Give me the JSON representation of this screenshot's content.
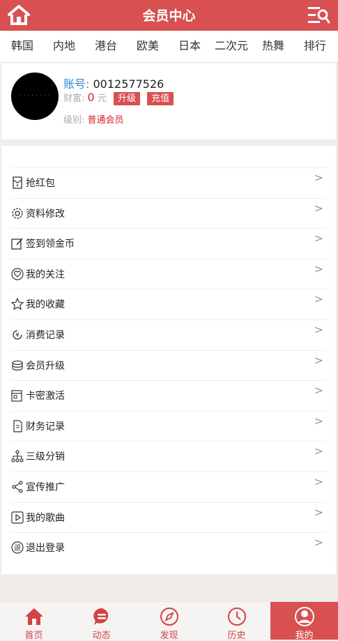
{
  "header": {
    "title": "会员中心"
  },
  "nav": [
    "韩国",
    "内地",
    "港台",
    "欧美",
    "日本",
    "二次元",
    "热舞",
    "排行"
  ],
  "profile": {
    "account_label": "账号:",
    "account_value": "0012577526",
    "wealth_label": "财富:",
    "wealth_value": "0",
    "wealth_unit": "元",
    "upgrade_button": "升级",
    "recharge_button": "充值",
    "level_label": "级别:",
    "level_value": "普通会员"
  },
  "menu": [
    {
      "label": "抢红包",
      "icon": "red-envelope-icon"
    },
    {
      "label": "资料修改",
      "icon": "gear-icon"
    },
    {
      "label": "签到领金币",
      "icon": "edit-icon"
    },
    {
      "label": "我的关注",
      "icon": "heart-icon"
    },
    {
      "label": "我的收藏",
      "icon": "star-icon"
    },
    {
      "label": "消费记录",
      "icon": "yen-icon"
    },
    {
      "label": "会员升级",
      "icon": "coins-icon"
    },
    {
      "label": "卡密激活",
      "icon": "card-icon"
    },
    {
      "label": "财务记录",
      "icon": "document-icon"
    },
    {
      "label": "三级分销",
      "icon": "hierarchy-icon"
    },
    {
      "label": "宣传推广",
      "icon": "share-icon"
    },
    {
      "label": "我的歌曲",
      "icon": "play-icon"
    },
    {
      "label": "退出登录",
      "icon": "logout-icon"
    }
  ],
  "menu_arrow": ">",
  "tabs": [
    {
      "label": "首页",
      "icon": "home-icon"
    },
    {
      "label": "动态",
      "icon": "chat-icon"
    },
    {
      "label": "发现",
      "icon": "compass-icon"
    },
    {
      "label": "历史",
      "icon": "clock-icon"
    },
    {
      "label": "我的",
      "icon": "user-icon"
    }
  ],
  "colors": {
    "brand": "#d85050",
    "accent_text": "#d9232d",
    "account_key": "#2b8bd1"
  }
}
